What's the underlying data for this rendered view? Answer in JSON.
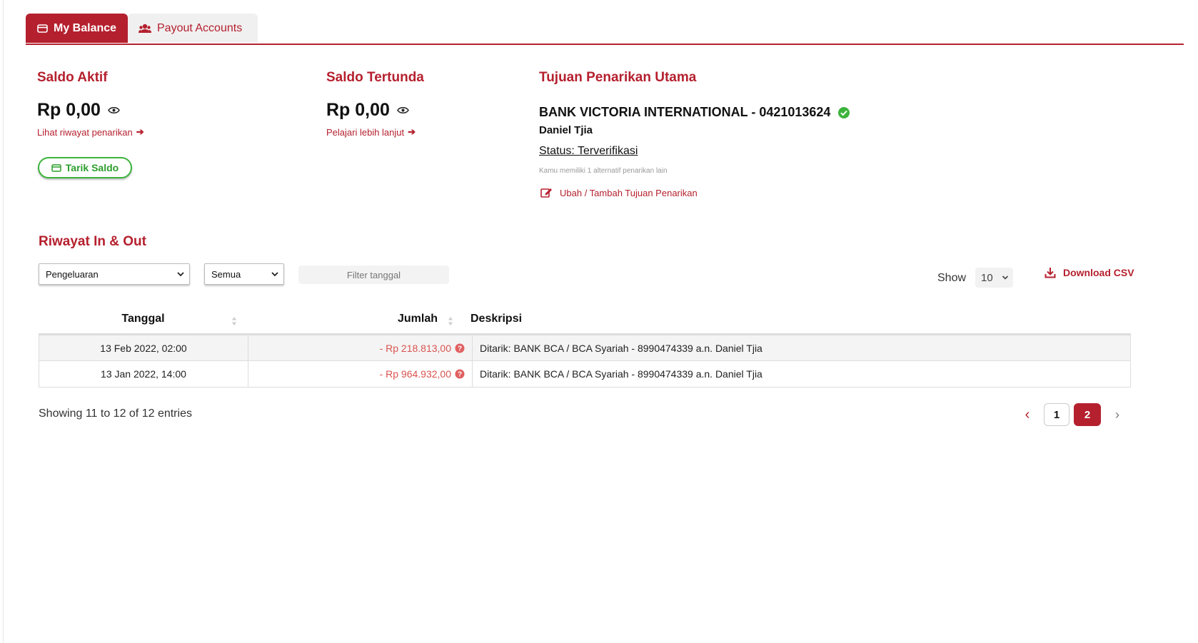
{
  "tabs": {
    "active": {
      "label": "My Balance",
      "icon": "card-icon"
    },
    "inactive": {
      "label": "Payout Accounts",
      "icon": "users-icon"
    }
  },
  "saldo_aktif": {
    "title": "Saldo Aktif",
    "amount": "Rp 0,00",
    "link": "Lihat riwayat penarikan",
    "button": "Tarik Saldo"
  },
  "saldo_tertunda": {
    "title": "Saldo Tertunda",
    "amount": "Rp 0,00",
    "link": "Pelajari lebih lanjut"
  },
  "tujuan": {
    "title": "Tujuan Penarikan Utama",
    "bank": "BANK VICTORIA INTERNATIONAL - 0421013624",
    "holder": "Daniel Tjia",
    "status": "Status: Terverifikasi",
    "note": "Kamu memiliki 1 alternatif penarikan lain",
    "edit": "Ubah / Tambah Tujuan Penarikan"
  },
  "riwayat": {
    "title": "Riwayat In & Out",
    "type_filter": "Pengeluaran",
    "status_filter": "Semua",
    "date_placeholder": "Filter tanggal",
    "show_label": "Show",
    "show_value": "10",
    "download": "Download CSV"
  },
  "table": {
    "headers": [
      "Tanggal",
      "Jumlah",
      "Deskripsi"
    ],
    "rows": [
      {
        "date": "13 Feb 2022, 02:00",
        "amount": "- Rp 218.813,00",
        "desc": "Ditarik: BANK BCA / BCA Syariah - 8990474339 a.n. Daniel Tjia"
      },
      {
        "date": "13 Jan 2022, 14:00",
        "amount": "- Rp 964.932,00",
        "desc": "Ditarik: BANK BCA / BCA Syariah - 8990474339 a.n. Daniel Tjia"
      }
    ]
  },
  "pagination": {
    "info": "Showing 11 to 12 of 12 entries",
    "prev": "‹",
    "pages": [
      "1",
      "2"
    ],
    "current": "2",
    "next": "›"
  },
  "colors": {
    "accent": "#b5202e",
    "success": "#3cb33c",
    "negative": "#d9534f"
  }
}
